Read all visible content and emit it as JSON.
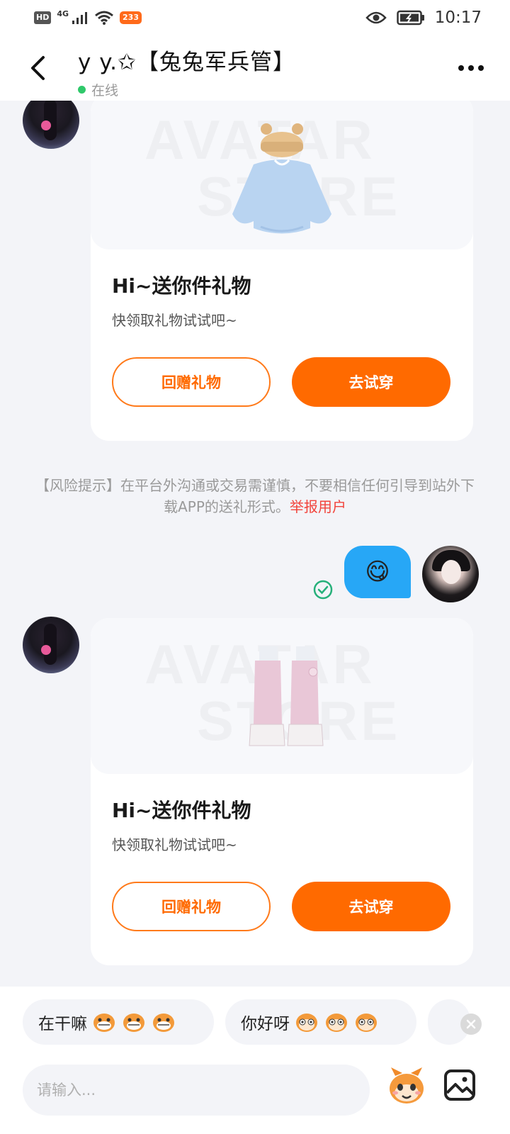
{
  "status_bar": {
    "hd_badge": "HD",
    "network": "4G",
    "app_badge": "233",
    "time": "10:17"
  },
  "header": {
    "title": "y y.✩【兔兔军兵管】",
    "status": "在线"
  },
  "messages": [
    {
      "type": "gift",
      "sender": "other",
      "title": "Hi~送你件礼物",
      "subtitle": "快领取礼物试试吧~",
      "return_label": "回赠礼物",
      "try_label": "去试穿",
      "item": "sweater-with-bear-hat"
    },
    {
      "type": "notice",
      "text": "【风险提示】在平台外沟通或交易需谨慎，不要相信任何引导到站外下载APP的送礼形式。",
      "link_text": "举报用户"
    },
    {
      "type": "emoji",
      "sender": "me",
      "emoji": "😋",
      "read": true
    },
    {
      "type": "gift",
      "sender": "other",
      "title": "Hi~送你件礼物",
      "subtitle": "快领取礼物试试吧~",
      "return_label": "回赠礼物",
      "try_label": "去试穿",
      "item": "pink-boots"
    }
  ],
  "watermark": [
    "AVATAR",
    "STORE"
  ],
  "quick_replies": [
    {
      "text": "在干嘛"
    },
    {
      "text": "你好呀"
    }
  ],
  "input": {
    "placeholder": "请输入..."
  },
  "colors": {
    "accent": "#ff6a00",
    "bubble": "#27a7f6",
    "online": "#2fc86a",
    "report": "#f2433b",
    "background": "#f3f4f8"
  },
  "icons": [
    "back-arrow-icon",
    "more-icon",
    "read-check-icon",
    "mascot-emoji-icon",
    "image-icon",
    "close-icon"
  ]
}
